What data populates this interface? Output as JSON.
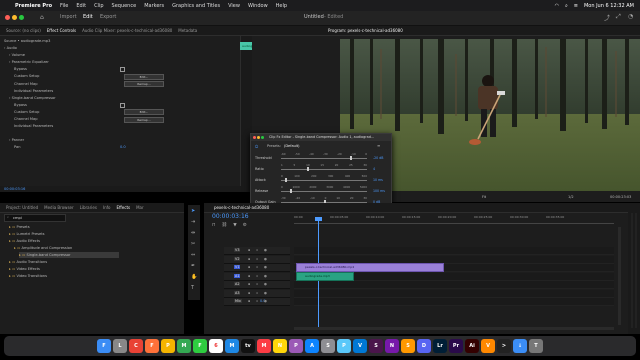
{
  "menubar": {
    "apple": "",
    "app": "Premiere Pro",
    "items": [
      "File",
      "Edit",
      "Clip",
      "Sequence",
      "Markers",
      "Graphics and Titles",
      "View",
      "Window",
      "Help"
    ],
    "clock": "Mon Jun 6  12:32 AM"
  },
  "titlebar": {
    "nav": [
      "Import",
      "Edit",
      "Export"
    ],
    "active": "Edit",
    "doc_title": "Untitled",
    "doc_status": "- Edited"
  },
  "top_tabs": {
    "source": "Source: (no clips)",
    "effect_controls": "Effect Controls",
    "mixer": "Audio Clip Mixer: pexels-c-technical-ad36080",
    "metadata": "Metadata"
  },
  "effect_controls": {
    "header": "Source • audiograde.mp3",
    "clip_label": "audiograde.mp3",
    "time": "00:00",
    "rows": [
      {
        "text": "Audio",
        "indent": 0,
        "blue": false
      },
      {
        "text": "Volume",
        "indent": 1,
        "blue": false
      },
      {
        "text": "Parametric Equalizer",
        "indent": 1,
        "blue": false
      },
      {
        "text": "Bypass",
        "indent": 2,
        "blue": false,
        "checkbox": true
      },
      {
        "text": "Custom Setup",
        "indent": 2,
        "blue": false,
        "button": "Edit..."
      },
      {
        "text": "Channel Map",
        "indent": 2,
        "blue": false,
        "button": "Remap..."
      },
      {
        "text": "Individual Parameters",
        "indent": 2,
        "blue": false
      },
      {
        "text": "Single-band Compressor",
        "indent": 1,
        "blue": false
      },
      {
        "text": "Bypass",
        "indent": 2,
        "blue": false,
        "checkbox": true
      },
      {
        "text": "Custom Setup",
        "indent": 2,
        "blue": false,
        "button": "Edit..."
      },
      {
        "text": "Channel Map",
        "indent": 2,
        "blue": false,
        "button": "Remap..."
      },
      {
        "text": "Individual Parameters",
        "indent": 2,
        "blue": false
      },
      {
        "text": "",
        "indent": 0,
        "blue": false
      },
      {
        "text": "Panner",
        "indent": 1,
        "blue": false
      },
      {
        "text": "Pan",
        "indent": 2,
        "blue": false,
        "value": "0.0"
      }
    ],
    "footer_time": "00:00:03:16"
  },
  "program": {
    "title": "Program: pexels-c-technical-ad36080",
    "timecode_left": "00:00:03:16",
    "fit": "Fit",
    "res": "1/2",
    "timecode_right": "00:00:23:03"
  },
  "clipfx": {
    "title": "Clip Fx Editor - Single-band Compressor: Audio 1, audiograd...",
    "presets_label": "Presets:",
    "presets_value": "(Default)",
    "params": [
      {
        "label": "Threshold",
        "value": "-20 dB",
        "fill": 0.8
      },
      {
        "label": "Ratio",
        "value": "4",
        "fill": 0.3
      },
      {
        "label": "Attack",
        "value": "10 ms",
        "fill": 0.05
      },
      {
        "label": "Release",
        "value": "100 ms",
        "fill": 0.1
      },
      {
        "label": "Output Gain",
        "value": "0 dB",
        "fill": 0.5
      }
    ],
    "scale_threshold": [
      "-60",
      "-50",
      "-40",
      "-30",
      "-20",
      "-10",
      "0"
    ],
    "scale_ratio": [
      "1",
      "5",
      "10",
      "15",
      "20",
      "25",
      "30"
    ],
    "scale_attack": [
      "0",
      "100",
      "200",
      "300",
      "400",
      "500"
    ],
    "scale_release": [
      "0",
      "1000",
      "2000",
      "3000",
      "4000",
      "5000"
    ],
    "scale_output": [
      "-30",
      "-20",
      "-10",
      "0",
      "10",
      "20",
      "30"
    ],
    "footer": "Fx | Ovl. 1"
  },
  "project": {
    "tabs": [
      "Project: Untitled",
      "Media Browser",
      "Libraries",
      "Info",
      "Effects",
      "Mar"
    ],
    "active": "Effects",
    "search": "cmpi",
    "tree": [
      {
        "text": "Presets",
        "indent": 1
      },
      {
        "text": "Lumetri Presets",
        "indent": 1
      },
      {
        "text": "Audio Effects",
        "indent": 1
      },
      {
        "text": "Amplitude and Compression",
        "indent": 2
      },
      {
        "text": "Single-band Compressor",
        "indent": 3,
        "selected": true
      },
      {
        "text": "Audio Transitions",
        "indent": 1
      },
      {
        "text": "Video Effects",
        "indent": 1
      },
      {
        "text": "Video Transitions",
        "indent": 1
      }
    ]
  },
  "timeline": {
    "tab": "pexels-c-technical-ad36080",
    "timecode": "00:00:03:16",
    "ruler": [
      "00:00",
      "00:00:05:00",
      "00:00:10:00",
      "00:00:15:00",
      "00:00:20:00",
      "00:00:25:00",
      "00:00:30:00",
      "00:00:35:00"
    ],
    "tracks": [
      {
        "id": "V3"
      },
      {
        "id": "V2"
      },
      {
        "id": "V1"
      },
      {
        "id": "A1"
      },
      {
        "id": "A2"
      },
      {
        "id": "A3"
      },
      {
        "id": "Mix",
        "value": "0.0"
      }
    ],
    "video_clip": "pexels-c-technical-ad36080.mp4",
    "audio_clip": "audiograde.mp3"
  },
  "dock": [
    {
      "name": "finder",
      "color": "#3b8df5",
      "glyph": "F"
    },
    {
      "name": "launchpad",
      "color": "#888",
      "glyph": "L"
    },
    {
      "name": "chrome",
      "color": "#e94235",
      "glyph": "C"
    },
    {
      "name": "firefox",
      "color": "#ff7139",
      "glyph": "F"
    },
    {
      "name": "photos",
      "color": "#f4b400",
      "glyph": "P"
    },
    {
      "name": "maps",
      "color": "#34a853",
      "glyph": "M"
    },
    {
      "name": "facetime",
      "color": "#2ecc40",
      "glyph": "F"
    },
    {
      "name": "calendar",
      "color": "#ffffff",
      "glyph": "6"
    },
    {
      "name": "mail",
      "color": "#1e88e5",
      "glyph": "M"
    },
    {
      "name": "tv",
      "color": "#111",
      "glyph": "tv"
    },
    {
      "name": "music",
      "color": "#fc3c44",
      "glyph": "M"
    },
    {
      "name": "notes",
      "color": "#ffd60a",
      "glyph": "N"
    },
    {
      "name": "podcasts",
      "color": "#9b59b6",
      "glyph": "P"
    },
    {
      "name": "app-store",
      "color": "#0d84ff",
      "glyph": "A"
    },
    {
      "name": "settings",
      "color": "#8e8e93",
      "glyph": "S"
    },
    {
      "name": "preview",
      "color": "#5ac8fa",
      "glyph": "P"
    },
    {
      "name": "vscode",
      "color": "#0078d4",
      "glyph": "V"
    },
    {
      "name": "slack",
      "color": "#4a154b",
      "glyph": "S"
    },
    {
      "name": "onenote",
      "color": "#7719aa",
      "glyph": "N"
    },
    {
      "name": "sublime",
      "color": "#ff9800",
      "glyph": "S"
    },
    {
      "name": "discord",
      "color": "#5865f2",
      "glyph": "D"
    },
    {
      "name": "lightroom",
      "color": "#001e36",
      "glyph": "Lr"
    },
    {
      "name": "premiere-pro",
      "color": "#2a0a4a",
      "glyph": "Pr"
    },
    {
      "name": "illustrator",
      "color": "#330000",
      "glyph": "Ai"
    },
    {
      "name": "vlc",
      "color": "#ff8800",
      "glyph": "V"
    },
    {
      "name": "terminal",
      "color": "#222",
      "glyph": ">"
    },
    {
      "name": "downloads",
      "color": "#3b8df5",
      "glyph": "↓"
    },
    {
      "name": "trash",
      "color": "#777",
      "glyph": "T"
    }
  ]
}
